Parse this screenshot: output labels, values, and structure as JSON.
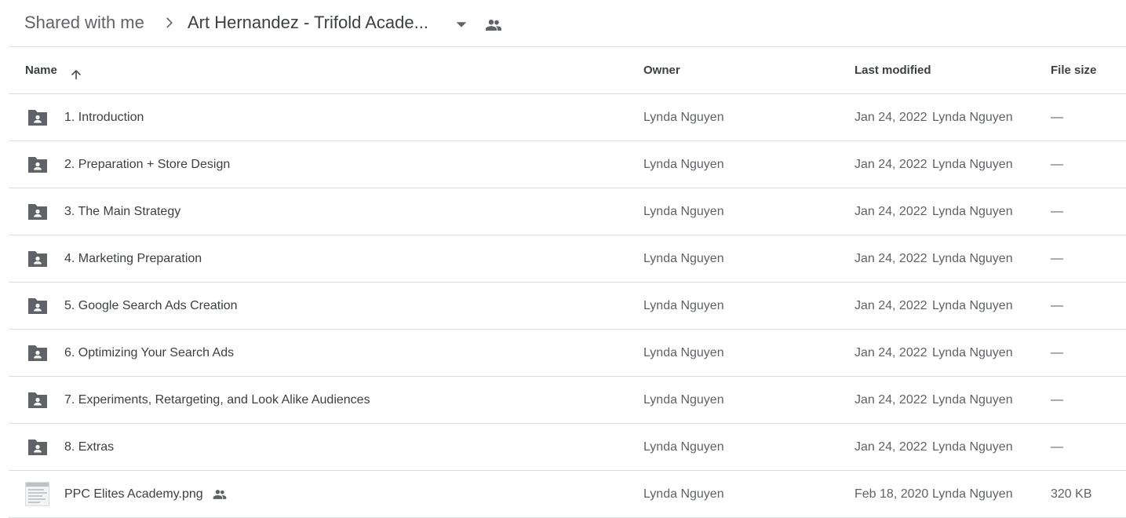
{
  "breadcrumb": {
    "root": "Shared with me",
    "current": "Art Hernandez - Trifold Acade...",
    "separator_icon": "chevron-right-icon",
    "dropdown_icon": "caret-down-icon",
    "shared_icon": "people-icon"
  },
  "columns": {
    "name": "Name",
    "owner": "Owner",
    "last_modified": "Last modified",
    "file_size": "File size",
    "sort_icon": "arrow-up-icon"
  },
  "colors": {
    "icon": "#5f6368",
    "text": "#3c4043",
    "muted": "#5f6368",
    "divider": "#dadce0"
  },
  "files": [
    {
      "name": "1. Introduction",
      "type": "shared-folder",
      "owner": "Lynda Nguyen",
      "modified": "Jan 24, 2022",
      "modified_by": "Lynda Nguyen",
      "size": "—"
    },
    {
      "name": "2. Preparation + Store Design",
      "type": "shared-folder",
      "owner": "Lynda Nguyen",
      "modified": "Jan 24, 2022",
      "modified_by": "Lynda Nguyen",
      "size": "—"
    },
    {
      "name": "3. The Main Strategy",
      "type": "shared-folder",
      "owner": "Lynda Nguyen",
      "modified": "Jan 24, 2022",
      "modified_by": "Lynda Nguyen",
      "size": "—"
    },
    {
      "name": "4. Marketing Preparation",
      "type": "shared-folder",
      "owner": "Lynda Nguyen",
      "modified": "Jan 24, 2022",
      "modified_by": "Lynda Nguyen",
      "size": "—"
    },
    {
      "name": "5. Google Search Ads Creation",
      "type": "shared-folder",
      "owner": "Lynda Nguyen",
      "modified": "Jan 24, 2022",
      "modified_by": "Lynda Nguyen",
      "size": "—"
    },
    {
      "name": "6. Optimizing Your Search Ads",
      "type": "shared-folder",
      "owner": "Lynda Nguyen",
      "modified": "Jan 24, 2022",
      "modified_by": "Lynda Nguyen",
      "size": "—"
    },
    {
      "name": "7. Experiments, Retargeting, and Look Alike Audiences",
      "type": "shared-folder",
      "owner": "Lynda Nguyen",
      "modified": "Jan 24, 2022",
      "modified_by": "Lynda Nguyen",
      "size": "—"
    },
    {
      "name": "8. Extras",
      "type": "shared-folder",
      "owner": "Lynda Nguyen",
      "modified": "Jan 24, 2022",
      "modified_by": "Lynda Nguyen",
      "size": "—"
    },
    {
      "name": "PPC Elites Academy.png",
      "type": "image",
      "shared": true,
      "owner": "Lynda Nguyen",
      "modified": "Feb 18, 2020",
      "modified_by": "Lynda Nguyen",
      "size": "320 KB"
    }
  ]
}
